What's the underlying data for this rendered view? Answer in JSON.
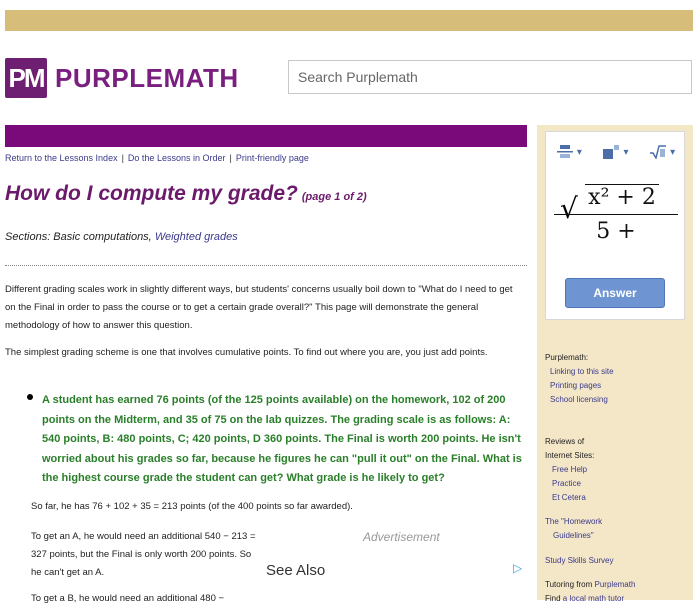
{
  "header": {
    "logo_mark": "PM",
    "logo_text": "PURPLEMATH",
    "search_placeholder": "Search Purplemath"
  },
  "nav": {
    "links": [
      "Return to the Lessons Index",
      "Do the Lessons in Order",
      "Print-friendly page"
    ],
    "separator": "|"
  },
  "article": {
    "title": "How do I compute my grade?",
    "page_label": "(page 1 of 2)",
    "sections_prefix": "Sections: Basic computations,",
    "sections_link": "Weighted grades",
    "intro": "Different grading scales work in slightly different ways, but students' concerns usually boil down to \"What do I need to get on the Final in order to pass the course or to get a certain grade overall?\" This page will demonstrate the general methodology of how to answer this question.",
    "simplest": "The simplest grading scheme is one that involves cumulative points. To find out where you are, you just add points.",
    "example": "A student has earned 76 points (of the 125 points available) on the homework, 102 of 200 points on the Midterm, and 35 of 75 on the lab quizzes. The grading scale is as follows: A: 540 points, B: 480 points, C; 420 points, D 360 points. The Final is worth 200 points. He isn't worried about his grades so far, because he figures he can \"pull it out\" on the Final. What is the highest course grade the student can get? What grade is he likely to get?",
    "so_far": "So far, he has 76 + 102 + 35 = 213 points (of the 400 points so far awarded).",
    "to_get_a": "To get an A, he would need an additional 540 − 213 = 327 points, but the Final is only worth 200 points. So he can't get an A.",
    "to_get_b": "To get a B, he would need an additional 480 −"
  },
  "ad": {
    "label": "Advertisement",
    "see_also": "See Also"
  },
  "widget": {
    "formula_rad": "x² + 2",
    "formula_den": "5 +",
    "answer_label": "Answer"
  },
  "sidebar": {
    "purplemath_heading": "Purplemath:",
    "purplemath_links": [
      "Linking to this site",
      "Printing pages",
      "School licensing"
    ],
    "reviews_heading_1": "Reviews of",
    "reviews_heading_2": "Internet Sites:",
    "reviews_links": [
      "Free Help",
      "Practice",
      "Et Cetera"
    ],
    "hw_guidelines_1": "The \"Homework",
    "hw_guidelines_2": "Guidelines\"",
    "study_skills": "Study Skills Survey",
    "tutoring_prefix": "Tutoring from",
    "tutoring_link": "Purplemath",
    "find_tutor_prefix": "Find",
    "find_tutor_link": "a local math tutor"
  },
  "colors": {
    "topbar": "#d6be7a",
    "brand_purple": "#7a0a7a",
    "title_purple": "#6b1a6b",
    "example_green": "#2a7f2a",
    "sidebar_bg": "#f4e7c8",
    "answer_button": "#6e94d2"
  }
}
